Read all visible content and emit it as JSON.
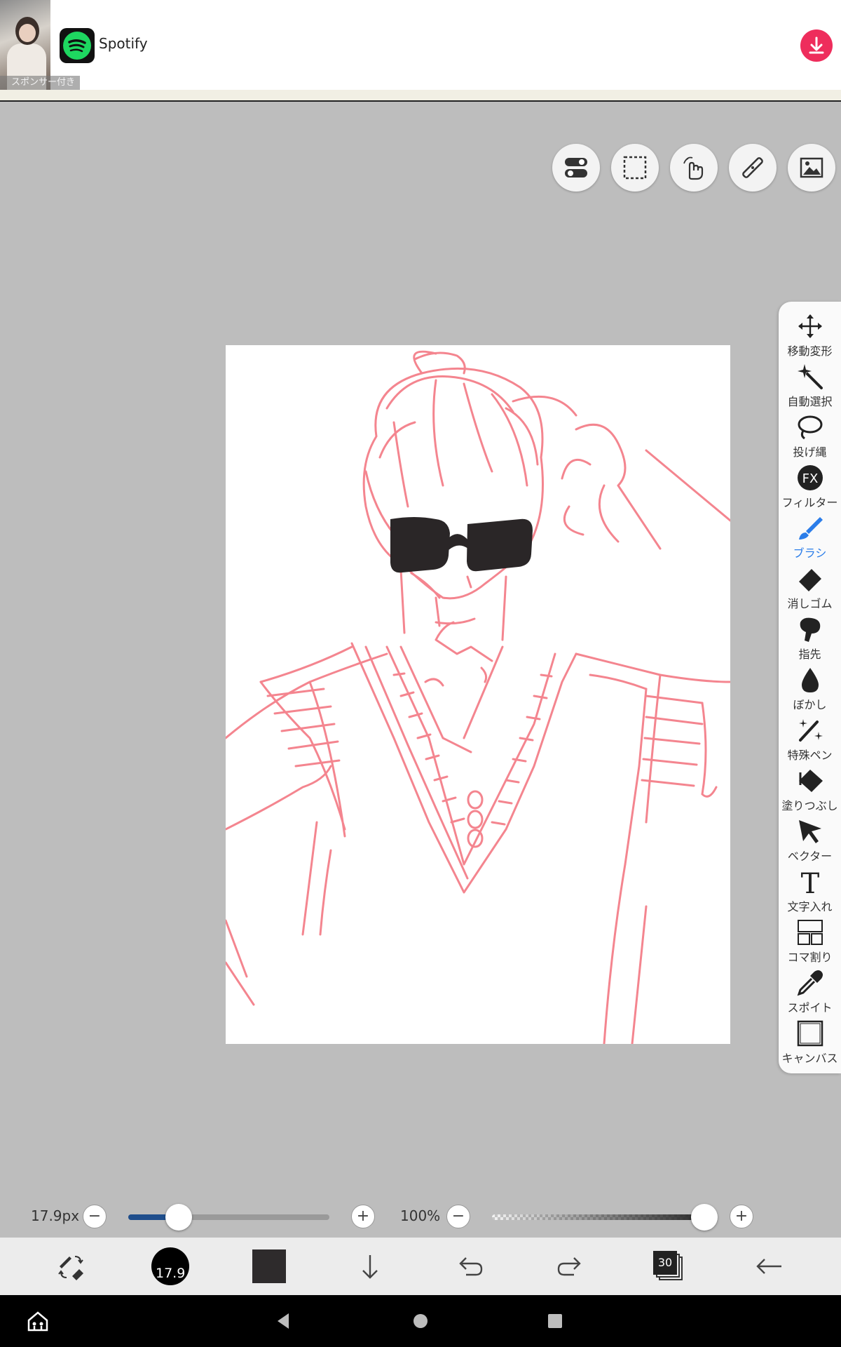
{
  "ad": {
    "sponsor_label": "スポンサー付き",
    "title": "Spotify",
    "logo_icon": "spotify-logo",
    "download_icon": "download-icon",
    "download_color": "#ee2d5c"
  },
  "top_tools": [
    {
      "name": "toggle-icon"
    },
    {
      "name": "selection-rect-icon"
    },
    {
      "name": "hand-touch-icon"
    },
    {
      "name": "ruler-icon"
    },
    {
      "name": "image-material-icon"
    }
  ],
  "palette": {
    "tools": [
      {
        "id": "move",
        "label": "移動変形",
        "icon": "move-icon"
      },
      {
        "id": "auto-select",
        "label": "自動選択",
        "icon": "magic-wand-icon"
      },
      {
        "id": "lasso",
        "label": "投げ縄",
        "icon": "lasso-icon"
      },
      {
        "id": "filter",
        "label": "フィルター",
        "icon": "fx-icon"
      },
      {
        "id": "brush",
        "label": "ブラシ",
        "icon": "brush-icon",
        "active": true
      },
      {
        "id": "eraser",
        "label": "消しゴム",
        "icon": "eraser-icon"
      },
      {
        "id": "finger",
        "label": "指先",
        "icon": "finger-icon"
      },
      {
        "id": "blur",
        "label": "ぼかし",
        "icon": "drop-icon"
      },
      {
        "id": "special-pen",
        "label": "特殊ペン",
        "icon": "sparkle-pen-icon"
      },
      {
        "id": "fill",
        "label": "塗りつぶし",
        "icon": "bucket-icon"
      },
      {
        "id": "vector",
        "label": "ベクター",
        "icon": "cursor-icon"
      },
      {
        "id": "text",
        "label": "文字入れ",
        "icon": "text-icon"
      },
      {
        "id": "panel",
        "label": "コマ割り",
        "icon": "panel-icon"
      },
      {
        "id": "eyedropper",
        "label": "スポイト",
        "icon": "eyedropper-icon"
      },
      {
        "id": "canvas",
        "label": "キャンバス",
        "icon": "canvas-icon"
      }
    ]
  },
  "sliders": {
    "brush_size_label": "17.9px",
    "brush_size_fraction": 0.25,
    "opacity_label": "100%",
    "opacity_fraction": 1.0,
    "minus": "−",
    "plus": "+"
  },
  "toolbar": {
    "brush_size_badge": "17.9",
    "layer_count": "30",
    "current_color": "#2e2b2c",
    "brush_icon_color": "#000000"
  },
  "navbar": {
    "home_icon": "app-home-icon"
  },
  "colors": {
    "accent": "#2b7de9",
    "sketch": "#f4858f",
    "background": "#bdbdbd"
  }
}
